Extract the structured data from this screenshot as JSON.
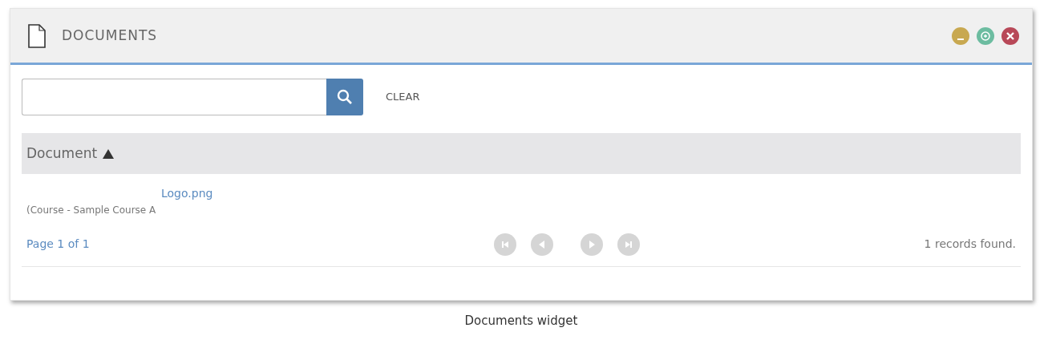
{
  "widget": {
    "title": "DOCUMENTS",
    "window_buttons": [
      {
        "kind": "minimize"
      },
      {
        "kind": "maximize"
      },
      {
        "kind": "close"
      }
    ]
  },
  "search": {
    "clear_label": "CLEAR"
  },
  "table": {
    "columns": [
      {
        "label": "Document",
        "sorted_ascending": true
      }
    ],
    "rows": [
      {
        "link": "Logo.png",
        "detail": "(Course - Sample Course A"
      }
    ]
  },
  "pager": {
    "page_info": "Page 1 of 1",
    "buttons": [
      {
        "kind": "first",
        "disabled": true
      },
      {
        "kind": "prev",
        "disabled": true
      },
      {
        "kind": "next",
        "disabled": true
      },
      {
        "kind": "last",
        "disabled": true
      }
    ],
    "records": "1 records found."
  },
  "caption": "Documents widget"
}
